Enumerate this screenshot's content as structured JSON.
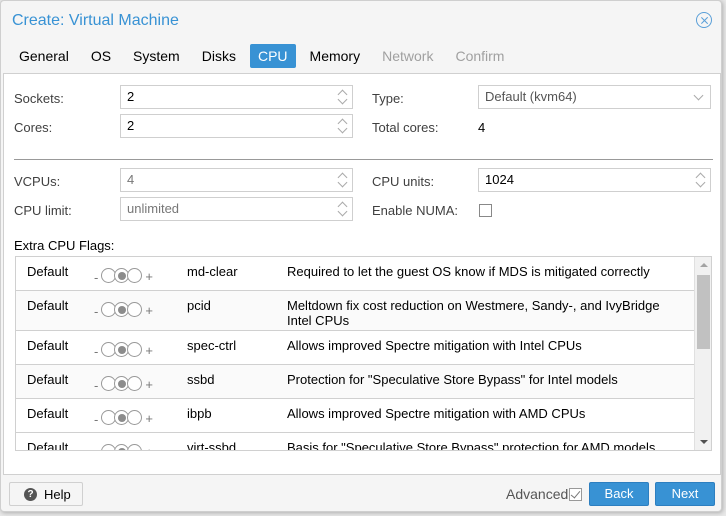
{
  "window": {
    "title": "Create: Virtual Machine",
    "close_icon": "close-circle-icon"
  },
  "tabs": [
    {
      "label": "General",
      "state": "normal"
    },
    {
      "label": "OS",
      "state": "normal"
    },
    {
      "label": "System",
      "state": "normal"
    },
    {
      "label": "Disks",
      "state": "normal"
    },
    {
      "label": "CPU",
      "state": "active"
    },
    {
      "label": "Memory",
      "state": "normal"
    },
    {
      "label": "Network",
      "state": "disabled"
    },
    {
      "label": "Confirm",
      "state": "disabled"
    }
  ],
  "form": {
    "sockets": {
      "label": "Sockets:",
      "value": "2"
    },
    "cores": {
      "label": "Cores:",
      "value": "2"
    },
    "type": {
      "label": "Type:",
      "value": "Default (kvm64)"
    },
    "total_cores": {
      "label": "Total cores:",
      "value": "4"
    },
    "vcpus": {
      "label": "VCPUs:",
      "value": "4"
    },
    "cpu_limit": {
      "label": "CPU limit:",
      "value": "unlimited"
    },
    "cpu_units": {
      "label": "CPU units:",
      "value": "1024"
    },
    "enable_numa": {
      "label": "Enable NUMA:",
      "checked": false
    },
    "extra_flags_label": "Extra CPU Flags:"
  },
  "flags": {
    "minus": "-",
    "plus": "+",
    "rows": [
      {
        "state": "Default",
        "flag": "md-clear",
        "description": "Required to let the guest OS know if MDS is mitigated correctly"
      },
      {
        "state": "Default",
        "flag": "pcid",
        "description": "Meltdown fix cost reduction on Westmere, Sandy-, and IvyBridge Intel CPUs"
      },
      {
        "state": "Default",
        "flag": "spec-ctrl",
        "description": "Allows improved Spectre mitigation with Intel CPUs"
      },
      {
        "state": "Default",
        "flag": "ssbd",
        "description": "Protection for \"Speculative Store Bypass\" for Intel models"
      },
      {
        "state": "Default",
        "flag": "ibpb",
        "description": "Allows improved Spectre mitigation with AMD CPUs"
      },
      {
        "state": "Default",
        "flag": "virt-ssbd",
        "description": "Basis for \"Speculative Store Bypass\" protection for AMD models"
      }
    ]
  },
  "footer": {
    "help_label": "Help",
    "advanced_label": "Advanced",
    "advanced_checked": true,
    "back_label": "Back",
    "next_label": "Next"
  },
  "colors": {
    "accent": "#3892d4",
    "disabled_text": "#a0a0a0"
  }
}
